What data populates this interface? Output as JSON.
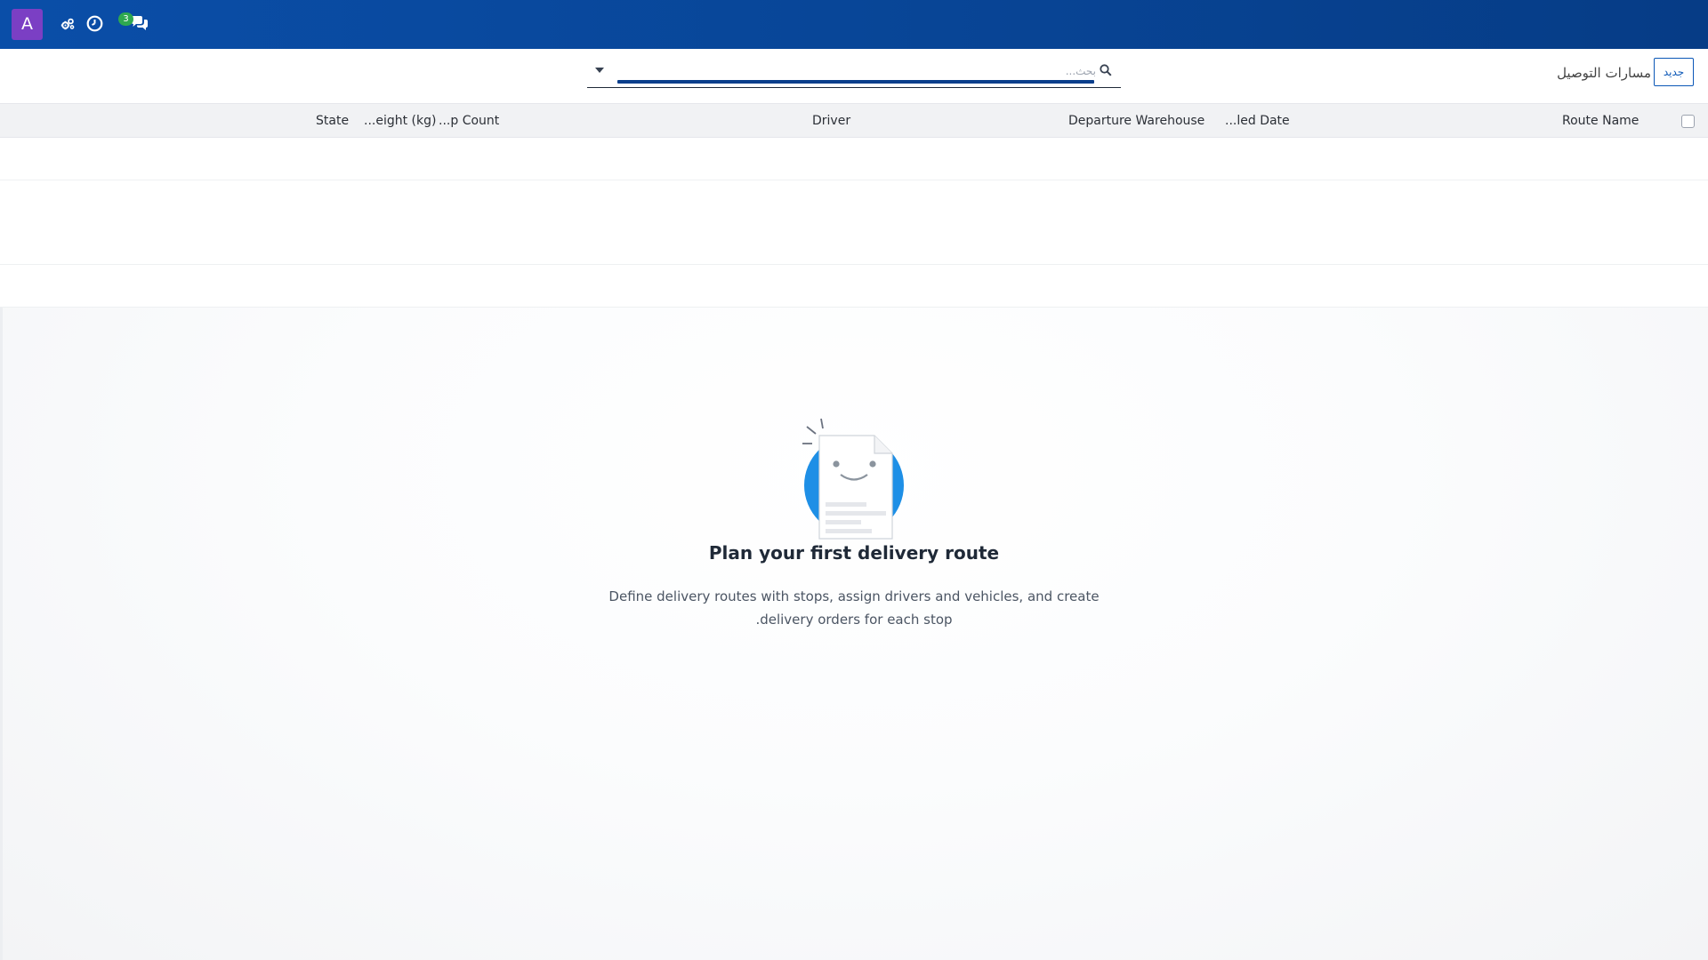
{
  "navbar": {
    "avatar_letter": "A",
    "messages_badge": "3",
    "icons": [
      "settings-cogs-icon",
      "clock-icon",
      "chat-icon"
    ],
    "colors": {
      "bar": "#0a4ea8",
      "avatar": "#7b3fc4",
      "badge": "#2fa84f"
    }
  },
  "control_panel": {
    "new_button_label": "جديد",
    "breadcrumb": "مسارات التوصيل",
    "search": {
      "placeholder": "بحث...",
      "value": ""
    }
  },
  "list": {
    "columns": [
      {
        "key": "route_name",
        "label": "Route Name"
      },
      {
        "key": "scheduled_date",
        "label": "...led Date"
      },
      {
        "key": "departure_warehouse",
        "label": "Departure Warehouse"
      },
      {
        "key": "driver",
        "label": "Driver"
      },
      {
        "key": "stop_count",
        "label": "...p Count"
      },
      {
        "key": "weight",
        "label": "...eight (kg)"
      },
      {
        "key": "state",
        "label": "State"
      }
    ],
    "rows": []
  },
  "empty_state": {
    "title": "Plan your first delivery route",
    "description_line1": "Define delivery routes with stops, assign drivers and vehicles, and create",
    "description_line2": ".delivery orders for each stop",
    "illustration": "smiling-document-icon"
  }
}
